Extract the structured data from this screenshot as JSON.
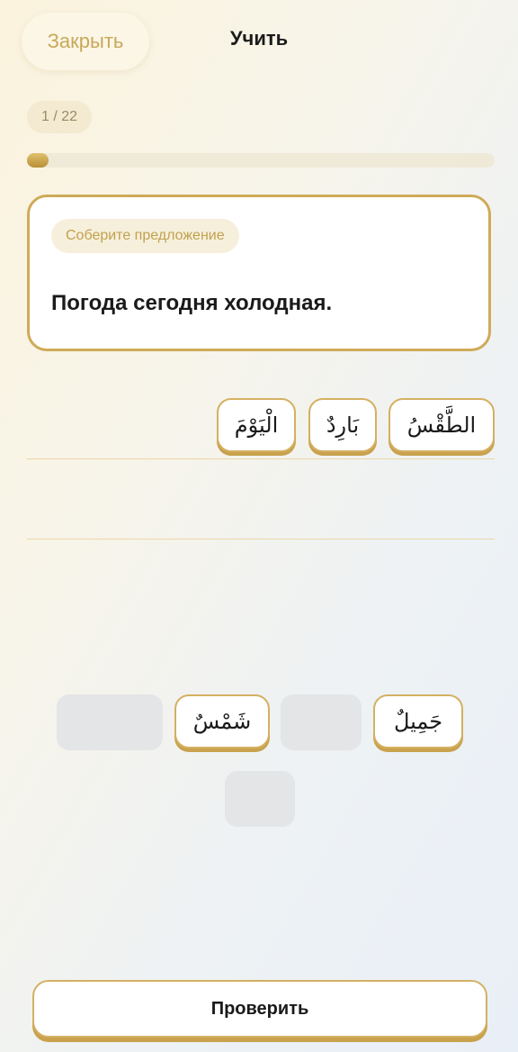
{
  "header": {
    "close_label": "Закрыть",
    "title": "Учить"
  },
  "progress": {
    "counter": "1 / 22",
    "current": 1,
    "total": 22
  },
  "card": {
    "instruction": "Соберите предложение",
    "prompt": "Погода сегодня холодная."
  },
  "answer": {
    "words": [
      "الطَّقْسُ",
      "بَارِدٌ",
      "الْيَوْمَ"
    ]
  },
  "bank": {
    "words": [
      "جَمِيلٌ",
      "شَمْسٌ"
    ]
  },
  "footer": {
    "check_label": "Проверить"
  },
  "colors": {
    "accent": "#cfab58",
    "accent_text": "#c8a85a"
  }
}
